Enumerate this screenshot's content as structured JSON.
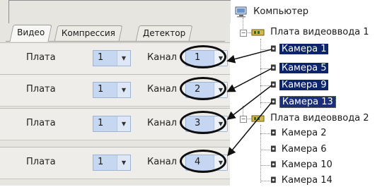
{
  "settings": {
    "tabs": [
      "Видео",
      "Компрессия",
      "Детектор"
    ],
    "active_tab": "Видео",
    "rows": [
      {
        "board_label": "Плата",
        "board_value": "1",
        "channel_label": "Канал",
        "channel_value": "1"
      },
      {
        "board_label": "Плата",
        "board_value": "1",
        "channel_label": "Канал",
        "channel_value": "2"
      },
      {
        "board_label": "Плата",
        "board_value": "1",
        "channel_label": "Канал",
        "channel_value": "3"
      },
      {
        "board_label": "Плата",
        "board_value": "1",
        "channel_label": "Канал",
        "channel_value": "4"
      }
    ]
  },
  "tree": {
    "root": "Компьютер",
    "boards": [
      {
        "label": "Плата видеоввода 1",
        "cameras": [
          "Камера 1",
          "Камера 5",
          "Камера 9",
          "Камера 13"
        ]
      },
      {
        "label": "Плата видеоввода 2",
        "cameras": [
          "Камера 2",
          "Камера 6",
          "Камера 10",
          "Камера 14"
        ]
      }
    ]
  },
  "colors": {
    "selection": "#0b246a",
    "combo_fill": "#c6d7f1"
  },
  "icons": {
    "root": "computer-icon",
    "board": "board-icon",
    "camera": "camera-icon",
    "dropdown": "chevron-down-icon",
    "collapse": "minus-box-icon"
  }
}
